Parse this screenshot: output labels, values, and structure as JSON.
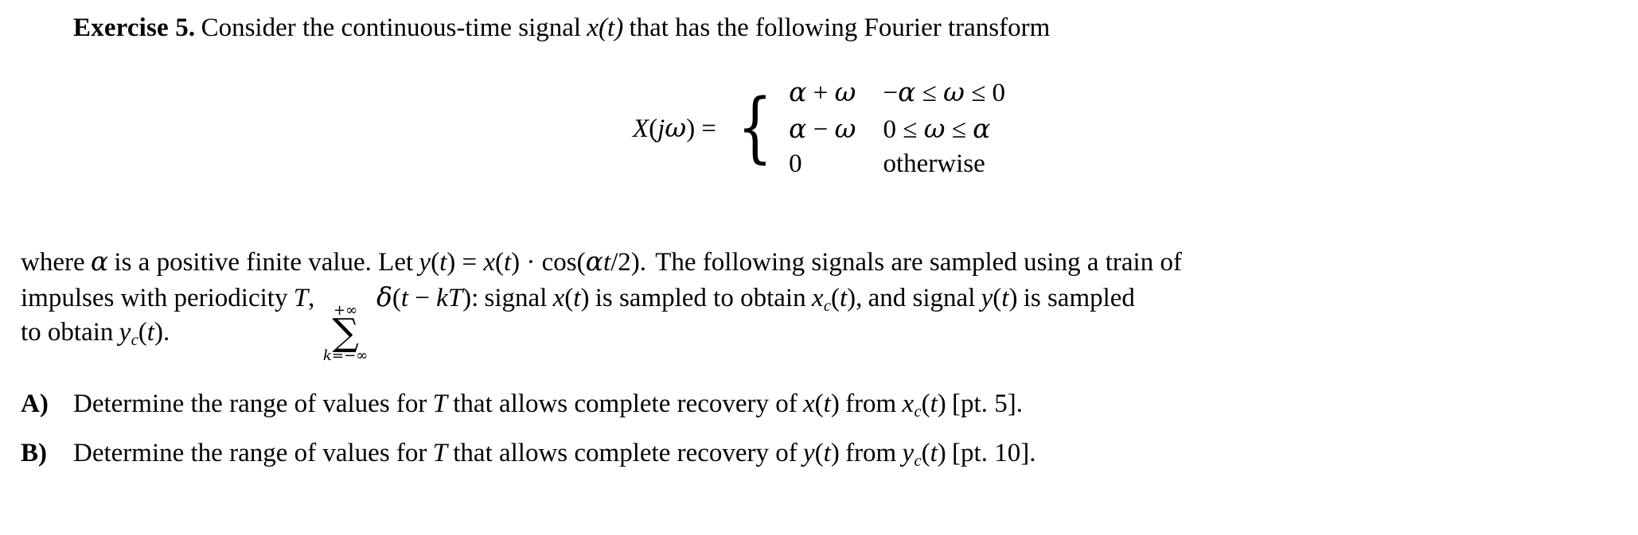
{
  "document": {
    "exercise": {
      "label": "Exercise 5.",
      "statement_before_x": "Consider the continuous-time signal",
      "signal_x": "x(t)",
      "statement_after_x": "that has the following Fourier transform"
    },
    "equation": {
      "lhs": "X(jω) =",
      "cases": [
        {
          "value": "α + ω",
          "condition": "−α ≤ ω ≤ 0"
        },
        {
          "value": "α − ω",
          "condition": "0 ≤ ω ≤ α"
        },
        {
          "value": "0",
          "condition": "otherwise"
        }
      ]
    },
    "paragraph": {
      "line1_a": "where",
      "line1_alpha": "α",
      "line1_b": "is a positive finite value. Let",
      "line1_def": "y(t) = x(t) · cos(αt/2).",
      "line1_c": "The following signals are sampled using a train of",
      "line2_a": "impulses with periodicity",
      "line2_T": "T,",
      "sum_upper": "+∞",
      "sum_symbol": "∑",
      "sum_lower": "k=−∞",
      "line2_delta": "δ(t − kT):",
      "line2_b": "signal",
      "line2_x": "x(t)",
      "line2_c": "is sampled to obtain",
      "line2_xc": "x_c(t),",
      "line2_d": "and signal",
      "line2_y": "y(t)",
      "line2_e": "is sampled",
      "line3_a": "to obtain",
      "line3_yc": "y_c(t)."
    },
    "items": [
      {
        "label": "A)",
        "text_a": "Determine the range of values for",
        "var_T": "T",
        "text_b": "that allows complete recovery of",
        "signal_from": "x(t)",
        "text_c": "from",
        "signal_sampled": "x_c(t)",
        "points": "[pt. 5]."
      },
      {
        "label": "B)",
        "text_a": "Determine the range of values for",
        "var_T": "T",
        "text_b": "that allows complete recovery of",
        "signal_from": "y(t)",
        "text_c": "from",
        "signal_sampled": "y_c(t)",
        "points": "[pt. 10]."
      }
    ]
  }
}
